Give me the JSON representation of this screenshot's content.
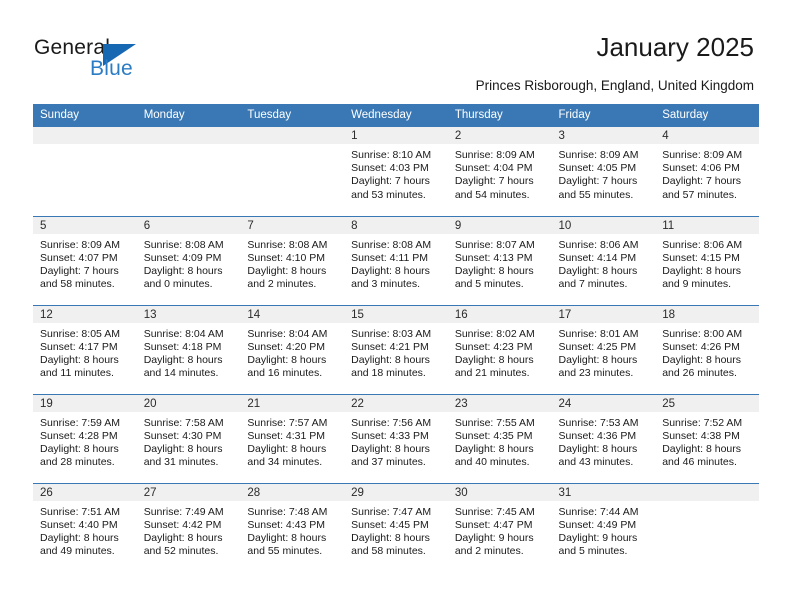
{
  "brand": {
    "name_part1": "General",
    "name_part2": "Blue",
    "accent_color": "#1668b3",
    "blue_text_color": "#2b7cc4"
  },
  "header": {
    "title": "January 2025",
    "subtitle": "Princes Risborough, England, United Kingdom"
  },
  "calendar": {
    "header_bg": "#3a78b5",
    "daynum_bg": "#f0f0f0",
    "weekdays": [
      "Sunday",
      "Monday",
      "Tuesday",
      "Wednesday",
      "Thursday",
      "Friday",
      "Saturday"
    ],
    "weeks": [
      [
        {
          "day": "",
          "empty": true
        },
        {
          "day": "",
          "empty": true
        },
        {
          "day": "",
          "empty": true
        },
        {
          "day": "1",
          "sunrise": "Sunrise: 8:10 AM",
          "sunset": "Sunset: 4:03 PM",
          "daylight1": "Daylight: 7 hours",
          "daylight2": "and 53 minutes."
        },
        {
          "day": "2",
          "sunrise": "Sunrise: 8:09 AM",
          "sunset": "Sunset: 4:04 PM",
          "daylight1": "Daylight: 7 hours",
          "daylight2": "and 54 minutes."
        },
        {
          "day": "3",
          "sunrise": "Sunrise: 8:09 AM",
          "sunset": "Sunset: 4:05 PM",
          "daylight1": "Daylight: 7 hours",
          "daylight2": "and 55 minutes."
        },
        {
          "day": "4",
          "sunrise": "Sunrise: 8:09 AM",
          "sunset": "Sunset: 4:06 PM",
          "daylight1": "Daylight: 7 hours",
          "daylight2": "and 57 minutes."
        }
      ],
      [
        {
          "day": "5",
          "sunrise": "Sunrise: 8:09 AM",
          "sunset": "Sunset: 4:07 PM",
          "daylight1": "Daylight: 7 hours",
          "daylight2": "and 58 minutes."
        },
        {
          "day": "6",
          "sunrise": "Sunrise: 8:08 AM",
          "sunset": "Sunset: 4:09 PM",
          "daylight1": "Daylight: 8 hours",
          "daylight2": "and 0 minutes."
        },
        {
          "day": "7",
          "sunrise": "Sunrise: 8:08 AM",
          "sunset": "Sunset: 4:10 PM",
          "daylight1": "Daylight: 8 hours",
          "daylight2": "and 2 minutes."
        },
        {
          "day": "8",
          "sunrise": "Sunrise: 8:08 AM",
          "sunset": "Sunset: 4:11 PM",
          "daylight1": "Daylight: 8 hours",
          "daylight2": "and 3 minutes."
        },
        {
          "day": "9",
          "sunrise": "Sunrise: 8:07 AM",
          "sunset": "Sunset: 4:13 PM",
          "daylight1": "Daylight: 8 hours",
          "daylight2": "and 5 minutes."
        },
        {
          "day": "10",
          "sunrise": "Sunrise: 8:06 AM",
          "sunset": "Sunset: 4:14 PM",
          "daylight1": "Daylight: 8 hours",
          "daylight2": "and 7 minutes."
        },
        {
          "day": "11",
          "sunrise": "Sunrise: 8:06 AM",
          "sunset": "Sunset: 4:15 PM",
          "daylight1": "Daylight: 8 hours",
          "daylight2": "and 9 minutes."
        }
      ],
      [
        {
          "day": "12",
          "sunrise": "Sunrise: 8:05 AM",
          "sunset": "Sunset: 4:17 PM",
          "daylight1": "Daylight: 8 hours",
          "daylight2": "and 11 minutes."
        },
        {
          "day": "13",
          "sunrise": "Sunrise: 8:04 AM",
          "sunset": "Sunset: 4:18 PM",
          "daylight1": "Daylight: 8 hours",
          "daylight2": "and 14 minutes."
        },
        {
          "day": "14",
          "sunrise": "Sunrise: 8:04 AM",
          "sunset": "Sunset: 4:20 PM",
          "daylight1": "Daylight: 8 hours",
          "daylight2": "and 16 minutes."
        },
        {
          "day": "15",
          "sunrise": "Sunrise: 8:03 AM",
          "sunset": "Sunset: 4:21 PM",
          "daylight1": "Daylight: 8 hours",
          "daylight2": "and 18 minutes."
        },
        {
          "day": "16",
          "sunrise": "Sunrise: 8:02 AM",
          "sunset": "Sunset: 4:23 PM",
          "daylight1": "Daylight: 8 hours",
          "daylight2": "and 21 minutes."
        },
        {
          "day": "17",
          "sunrise": "Sunrise: 8:01 AM",
          "sunset": "Sunset: 4:25 PM",
          "daylight1": "Daylight: 8 hours",
          "daylight2": "and 23 minutes."
        },
        {
          "day": "18",
          "sunrise": "Sunrise: 8:00 AM",
          "sunset": "Sunset: 4:26 PM",
          "daylight1": "Daylight: 8 hours",
          "daylight2": "and 26 minutes."
        }
      ],
      [
        {
          "day": "19",
          "sunrise": "Sunrise: 7:59 AM",
          "sunset": "Sunset: 4:28 PM",
          "daylight1": "Daylight: 8 hours",
          "daylight2": "and 28 minutes."
        },
        {
          "day": "20",
          "sunrise": "Sunrise: 7:58 AM",
          "sunset": "Sunset: 4:30 PM",
          "daylight1": "Daylight: 8 hours",
          "daylight2": "and 31 minutes."
        },
        {
          "day": "21",
          "sunrise": "Sunrise: 7:57 AM",
          "sunset": "Sunset: 4:31 PM",
          "daylight1": "Daylight: 8 hours",
          "daylight2": "and 34 minutes."
        },
        {
          "day": "22",
          "sunrise": "Sunrise: 7:56 AM",
          "sunset": "Sunset: 4:33 PM",
          "daylight1": "Daylight: 8 hours",
          "daylight2": "and 37 minutes."
        },
        {
          "day": "23",
          "sunrise": "Sunrise: 7:55 AM",
          "sunset": "Sunset: 4:35 PM",
          "daylight1": "Daylight: 8 hours",
          "daylight2": "and 40 minutes."
        },
        {
          "day": "24",
          "sunrise": "Sunrise: 7:53 AM",
          "sunset": "Sunset: 4:36 PM",
          "daylight1": "Daylight: 8 hours",
          "daylight2": "and 43 minutes."
        },
        {
          "day": "25",
          "sunrise": "Sunrise: 7:52 AM",
          "sunset": "Sunset: 4:38 PM",
          "daylight1": "Daylight: 8 hours",
          "daylight2": "and 46 minutes."
        }
      ],
      [
        {
          "day": "26",
          "sunrise": "Sunrise: 7:51 AM",
          "sunset": "Sunset: 4:40 PM",
          "daylight1": "Daylight: 8 hours",
          "daylight2": "and 49 minutes."
        },
        {
          "day": "27",
          "sunrise": "Sunrise: 7:49 AM",
          "sunset": "Sunset: 4:42 PM",
          "daylight1": "Daylight: 8 hours",
          "daylight2": "and 52 minutes."
        },
        {
          "day": "28",
          "sunrise": "Sunrise: 7:48 AM",
          "sunset": "Sunset: 4:43 PM",
          "daylight1": "Daylight: 8 hours",
          "daylight2": "and 55 minutes."
        },
        {
          "day": "29",
          "sunrise": "Sunrise: 7:47 AM",
          "sunset": "Sunset: 4:45 PM",
          "daylight1": "Daylight: 8 hours",
          "daylight2": "and 58 minutes."
        },
        {
          "day": "30",
          "sunrise": "Sunrise: 7:45 AM",
          "sunset": "Sunset: 4:47 PM",
          "daylight1": "Daylight: 9 hours",
          "daylight2": "and 2 minutes."
        },
        {
          "day": "31",
          "sunrise": "Sunrise: 7:44 AM",
          "sunset": "Sunset: 4:49 PM",
          "daylight1": "Daylight: 9 hours",
          "daylight2": "and 5 minutes."
        },
        {
          "day": "",
          "empty": true
        }
      ]
    ]
  }
}
